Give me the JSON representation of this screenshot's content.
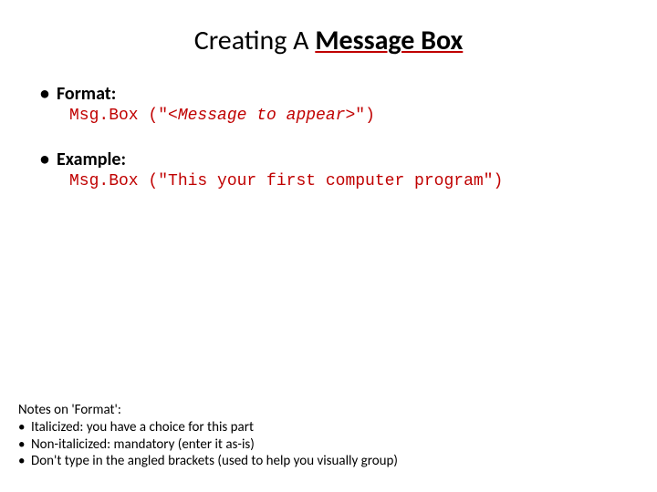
{
  "title": {
    "part1": "Creating A ",
    "part2": "Message Box"
  },
  "sections": [
    {
      "heading": "Format:",
      "code_prefix": "Msg.Box (\"",
      "code_italic": "<Message to appear>",
      "code_suffix": "\")"
    },
    {
      "heading": "Example:",
      "code_full": "Msg.Box (\"This your first computer program\")"
    }
  ],
  "notes": {
    "title": "Notes on 'Format':",
    "items": [
      "Italicized: you have a choice for this part",
      "Non-italicized: mandatory (enter it as-is)",
      "Don't type in the angled brackets (used to help you visually group)"
    ]
  }
}
